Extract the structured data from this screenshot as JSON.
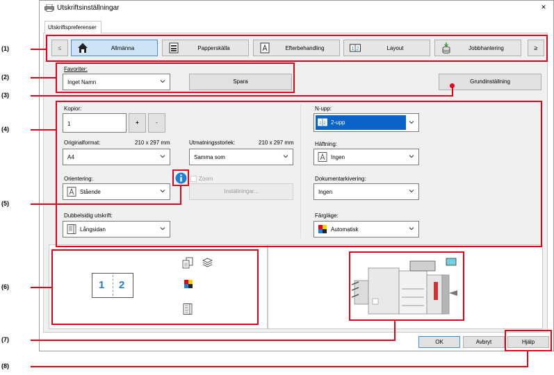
{
  "window": {
    "title": "Utskriftsinställningar",
    "close_glyph": "×"
  },
  "tabstrip": {
    "tab_label": "Utskriftspreferenser"
  },
  "nav": {
    "prev_glyph": "≤",
    "next_glyph": "≥",
    "items": [
      {
        "label": "Allmänna",
        "icon": "home-icon",
        "active": true
      },
      {
        "label": "Papperskälla",
        "icon": "paper-tray-icon",
        "active": false
      },
      {
        "label": "Efterbehandling",
        "icon": "finishing-icon",
        "active": false
      },
      {
        "label": "Layout",
        "icon": "layout-icon",
        "active": false
      },
      {
        "label": "Jobbhantering",
        "icon": "job-icon",
        "active": false
      }
    ]
  },
  "favorites": {
    "label": "Favoriter:",
    "value": "Inget Namn",
    "save_label": "Spara"
  },
  "defaults_button": "Grundinställning",
  "copies": {
    "label": "Kopior:",
    "value": "1",
    "plus": "+",
    "minus": "-"
  },
  "original_format": {
    "label": "Originalformat:",
    "size": "210 x 297 mm",
    "value": "A4"
  },
  "output_size": {
    "label": "Utmatningsstorlek:",
    "size": "210 x 297 mm",
    "value": "Samma som"
  },
  "orientation": {
    "label": "Orientering:",
    "value": "Stående"
  },
  "zoom": {
    "label": "Zoom",
    "settings_label": "Inställningar..."
  },
  "duplex": {
    "label": "Dubbelsidig utskrift:",
    "value": "Långsidan"
  },
  "nup": {
    "label": "N-upp:",
    "value": "2-upp"
  },
  "stapling": {
    "label": "Häftning:",
    "value": "Ingen"
  },
  "doc_filing": {
    "label": "Dokumentarkivering:",
    "value": "Ingen"
  },
  "color_mode": {
    "label": "Färgläge:",
    "value": "Automatisk"
  },
  "preview": {
    "page_left": "1",
    "page_right": "2"
  },
  "footer": {
    "ok": "OK",
    "cancel": "Avbryt",
    "help": "Hjälp"
  },
  "callouts": [
    "(1)",
    "(2)",
    "(3)",
    "(4)",
    "(5)",
    "(6)",
    "(7)",
    "(8)"
  ],
  "colors": {
    "accent": "#3c8fd9",
    "callout_red": "#e3001b",
    "selected_bg": "#0a64c8",
    "info_blue": "#1e7fd6"
  }
}
